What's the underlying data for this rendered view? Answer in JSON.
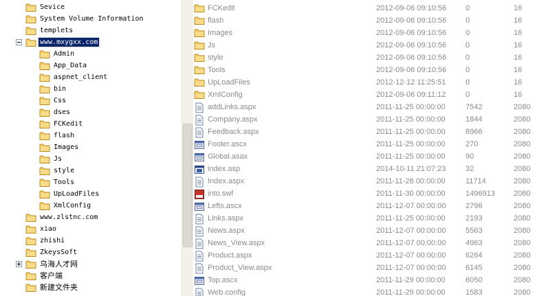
{
  "tree": {
    "items": [
      {
        "label": "Sevice",
        "depth": 0
      },
      {
        "label": "System Volume Information",
        "depth": 0
      },
      {
        "label": "templets",
        "depth": 0
      },
      {
        "label": "www.mxygxx.com",
        "depth": 0,
        "expander": "minus",
        "selected": true
      },
      {
        "label": "Admin",
        "depth": 1
      },
      {
        "label": "App_Data",
        "depth": 1
      },
      {
        "label": "aspnet_client",
        "depth": 1
      },
      {
        "label": "bin",
        "depth": 1
      },
      {
        "label": "Css",
        "depth": 1
      },
      {
        "label": "dses",
        "depth": 1
      },
      {
        "label": "FCKedit",
        "depth": 1
      },
      {
        "label": "flash",
        "depth": 1
      },
      {
        "label": "Images",
        "depth": 1
      },
      {
        "label": "Js",
        "depth": 1
      },
      {
        "label": "style",
        "depth": 1
      },
      {
        "label": "Tools",
        "depth": 1
      },
      {
        "label": "UpLoadFiles",
        "depth": 1
      },
      {
        "label": "XmlConfig",
        "depth": 1
      },
      {
        "label": "www.zlstnc.com",
        "depth": 0
      },
      {
        "label": "xiao",
        "depth": 0
      },
      {
        "label": "zhishi",
        "depth": 0
      },
      {
        "label": "ZkeysSoft",
        "depth": 0
      },
      {
        "label": "乌海人才网",
        "depth": 0,
        "expander": "plus"
      },
      {
        "label": "客户端",
        "depth": 0
      },
      {
        "label": "新建文件夹",
        "depth": 0
      }
    ]
  },
  "files": [
    {
      "name": "FCKedit",
      "date": "2012-09-06 09:10:56",
      "size": "0",
      "attr": "16",
      "icon": "folder-icon"
    },
    {
      "name": "flash",
      "date": "2012-09-06 09:10:56",
      "size": "0",
      "attr": "16",
      "icon": "folder-icon"
    },
    {
      "name": "Images",
      "date": "2012-09-06 09:10:56",
      "size": "0",
      "attr": "16",
      "icon": "folder-icon"
    },
    {
      "name": "Js",
      "date": "2012-09-06 09:10:56",
      "size": "0",
      "attr": "16",
      "icon": "folder-icon"
    },
    {
      "name": "style",
      "date": "2012-09-06 09:10:56",
      "size": "0",
      "attr": "16",
      "icon": "folder-icon"
    },
    {
      "name": "Tools",
      "date": "2012-09-06 09:10:56",
      "size": "0",
      "attr": "16",
      "icon": "folder-icon"
    },
    {
      "name": "UpLoadFiles",
      "date": "2012-12-12 11:25:51",
      "size": "0",
      "attr": "16",
      "icon": "folder-icon"
    },
    {
      "name": "XmlConfig",
      "date": "2012-09-06 09:11:12",
      "size": "0",
      "attr": "16",
      "icon": "folder-icon"
    },
    {
      "name": "addLinks.aspx",
      "date": "2011-11-25 00:00:00",
      "size": "7542",
      "attr": "2080",
      "icon": "document-icon"
    },
    {
      "name": "Company.aspx",
      "date": "2011-11-25 00:00:00",
      "size": "1844",
      "attr": "2080",
      "icon": "document-icon"
    },
    {
      "name": "Feedback.aspx",
      "date": "2011-11-25 00:00:00",
      "size": "8966",
      "attr": "2080",
      "icon": "document-icon"
    },
    {
      "name": "Footer.ascx",
      "date": "2011-11-25 00:00:00",
      "size": "270",
      "attr": "2080",
      "icon": "control-icon"
    },
    {
      "name": "Global.asax",
      "date": "2011-11-25 00:00:00",
      "size": "90",
      "attr": "2080",
      "icon": "control-icon"
    },
    {
      "name": "index.asp",
      "date": "2014-10-11 21:07:23",
      "size": "32",
      "attr": "2080",
      "icon": "asp-icon"
    },
    {
      "name": "Index.aspx",
      "date": "2011-11-28 00:00:00",
      "size": "11714",
      "attr": "2080",
      "icon": "document-icon"
    },
    {
      "name": "into.swf",
      "date": "2011-11-30 00:00:00",
      "size": "1496913",
      "attr": "2080",
      "icon": "flash-icon"
    },
    {
      "name": "Lefts.ascx",
      "date": "2011-12-07 00:00:00",
      "size": "2796",
      "attr": "2080",
      "icon": "control-icon"
    },
    {
      "name": "Links.aspx",
      "date": "2011-11-25 00:00:00",
      "size": "2193",
      "attr": "2080",
      "icon": "document-icon"
    },
    {
      "name": "News.aspx",
      "date": "2011-12-07 00:00:00",
      "size": "5563",
      "attr": "2080",
      "icon": "document-icon"
    },
    {
      "name": "News_View.aspx",
      "date": "2011-12-07 00:00:00",
      "size": "4963",
      "attr": "2080",
      "icon": "document-icon"
    },
    {
      "name": "Product.aspx",
      "date": "2011-12-07 00:00:00",
      "size": "6264",
      "attr": "2080",
      "icon": "document-icon"
    },
    {
      "name": "Product_View.aspx",
      "date": "2011-12-07 00:00:00",
      "size": "6145",
      "attr": "2080",
      "icon": "document-icon"
    },
    {
      "name": "Top.ascx",
      "date": "2011-11-29 00:00:00",
      "size": "6050",
      "attr": "2080",
      "icon": "control-icon"
    },
    {
      "name": "Web.config",
      "date": "2011-11-29 00:00:00",
      "size": "1583",
      "attr": "2080",
      "icon": "document-icon"
    }
  ],
  "colors": {
    "selection": "#0a246a",
    "folder": "#f3c45a",
    "list_text": "#8a8a8a"
  }
}
